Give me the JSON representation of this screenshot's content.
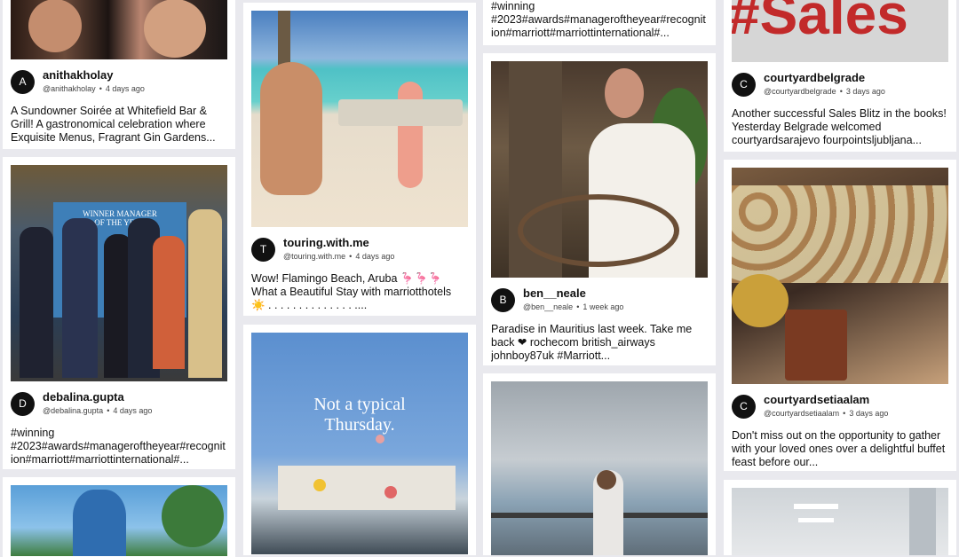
{
  "posts": [
    {
      "initial": "A",
      "name": "anithakholay",
      "handle": "@anithakholay",
      "time": "4 days ago",
      "caption": "A Sundowner Soirée at Whitefield Bar & Grill! A gastronomical celebration where Exquisite Menus, Fragrant Gin Gardens..."
    },
    {
      "initial": "D",
      "name": "debalina.gupta",
      "handle": "@debalina.gupta",
      "time": "4 days ago",
      "caption": "#winning #2023#awards#manageroftheyear#recognition#marriott#marriottinternational#..."
    },
    {
      "initial": "T",
      "name": "touring.with.me",
      "handle": "@touring.with.me",
      "time": "4 days ago",
      "caption": "Wow! Flamingo Beach, Aruba 🦩🦩🦩 What a Beautiful Stay with marriotthotels ☀️ . . . . . . . . . . . . . . ...."
    },
    {
      "initial": "",
      "name": "",
      "handle": "",
      "time": "",
      "caption": "#winning #2023#awards#manageroftheyear#recognition#marriott#marriottinternational#..."
    },
    {
      "initial": "B",
      "name": "ben__neale",
      "handle": "@ben__neale",
      "time": "1 week ago",
      "caption": "Paradise in Mauritius last week. Take me back ❤ rochecom british_airways johnboy87uk #Marriott..."
    },
    {
      "initial": "C",
      "name": "courtyardbelgrade",
      "handle": "@courtyardbelgrade",
      "time": "3 days ago",
      "caption": "Another successful Sales Blitz in the books! Yesterday Belgrade welcomed courtyardsarajevo fourpointsljubljana..."
    },
    {
      "initial": "C",
      "name": "courtyardsetiaalam",
      "handle": "@courtyardsetiaalam",
      "time": "3 days ago",
      "caption": "Don't miss out on the opportunity to gather with your loved ones over a delightful buffet feast before our..."
    }
  ],
  "image_texts": {
    "award_sign": "WINNER MANAGER OF THE YEAR",
    "thursday": "Not a typical Thursday.",
    "sales": "#Sales"
  }
}
